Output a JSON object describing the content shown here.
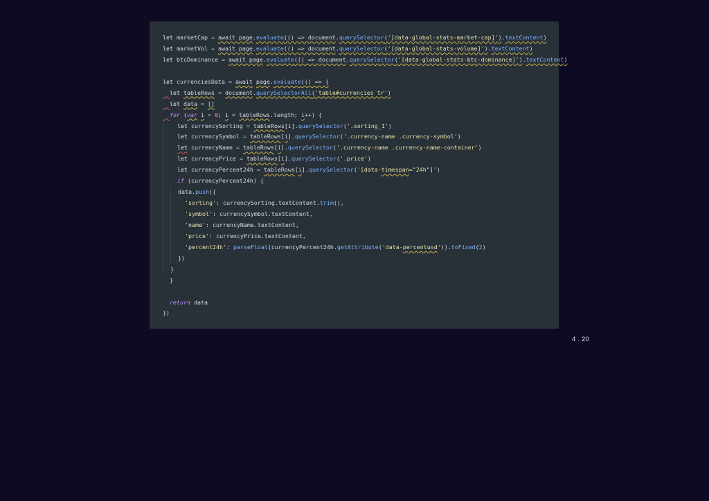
{
  "slide": {
    "page_number": "4 . 20"
  },
  "code_snippet": {
    "lines": [
      "let marketCap = await page.evaluate(() => document.querySelector('[data-global-stats-market-cap]').textContent)",
      "let marketVol = await page.evaluate(() => document.querySelector('[data-global-stats-volume]').textContent)",
      "let btcDominance = await page.evaluate(() => document.querySelector('[data-global-stats-btc-dominance]').textContent)",
      "",
      "let currenciesData = await page.evaluate(() => {",
      "  let tableRows = document.querySelectorAll('table#currencies tr')",
      "  let data = []",
      "  for (var i = 0; i < tableRows.length; i++) {",
      "    let currencySorting = tableRows[i].querySelector('.sorting_1')",
      "    let currencySymbol = tableRows[i].querySelector('.currency-name .currency-symbol')",
      "    let currencyName = tableRows[i].querySelector('.currency-name .currency-name-container')",
      "    let currencyPrice = tableRows[i].querySelector('.price')",
      "    let currencyPercent24h = tableRows[i].querySelector('[data-timespan=\"24h\"]')",
      "    if (currencyPercent24h) {",
      "      data.push({",
      "        'sorting': currencySorting.textContent.trim(),",
      "        'symbol': currencySymbol.textContent,",
      "        'name': currencyName.textContent,",
      "        'price': currencyPrice.textContent,",
      "        'percent24h': parseFloat(currencyPercent24h.getAttribute('data-percentusd')).toFixed(2)",
      "      })",
      "    }",
      "  }",
      "",
      "  return data",
      "})"
    ]
  },
  "colors": {
    "background": "#0e0a24",
    "code_panel": "#283038",
    "string": "#e8e2a8",
    "function": "#7fb2ff",
    "keyword_italic": "#c993ff",
    "number": "#f59a8c"
  }
}
